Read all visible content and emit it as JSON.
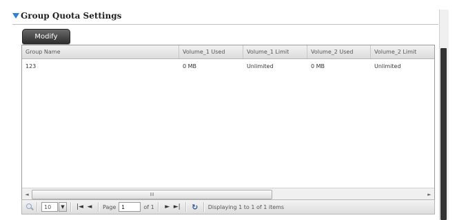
{
  "section": {
    "title": "Group Quota Settings"
  },
  "toolbar": {
    "modify_label": "Modify"
  },
  "grid": {
    "columns": [
      "Group Name",
      "Volume_1  Used",
      "Volume_1  Limit",
      "Volume_2  Used",
      "Volume_2  Limit"
    ],
    "rows": [
      [
        "123",
        "0 MB",
        "Unlimited",
        "0 MB",
        "Unlimited"
      ]
    ],
    "hscroll_grip": "III"
  },
  "pager": {
    "page_size": "10",
    "page_label": "Page",
    "page_value": "1",
    "of_label": "of 1",
    "display_text": "Displaying 1 to 1 of 1 items"
  },
  "colors": {
    "accent": "#2f7fd6",
    "button": "#3a3a3a"
  }
}
